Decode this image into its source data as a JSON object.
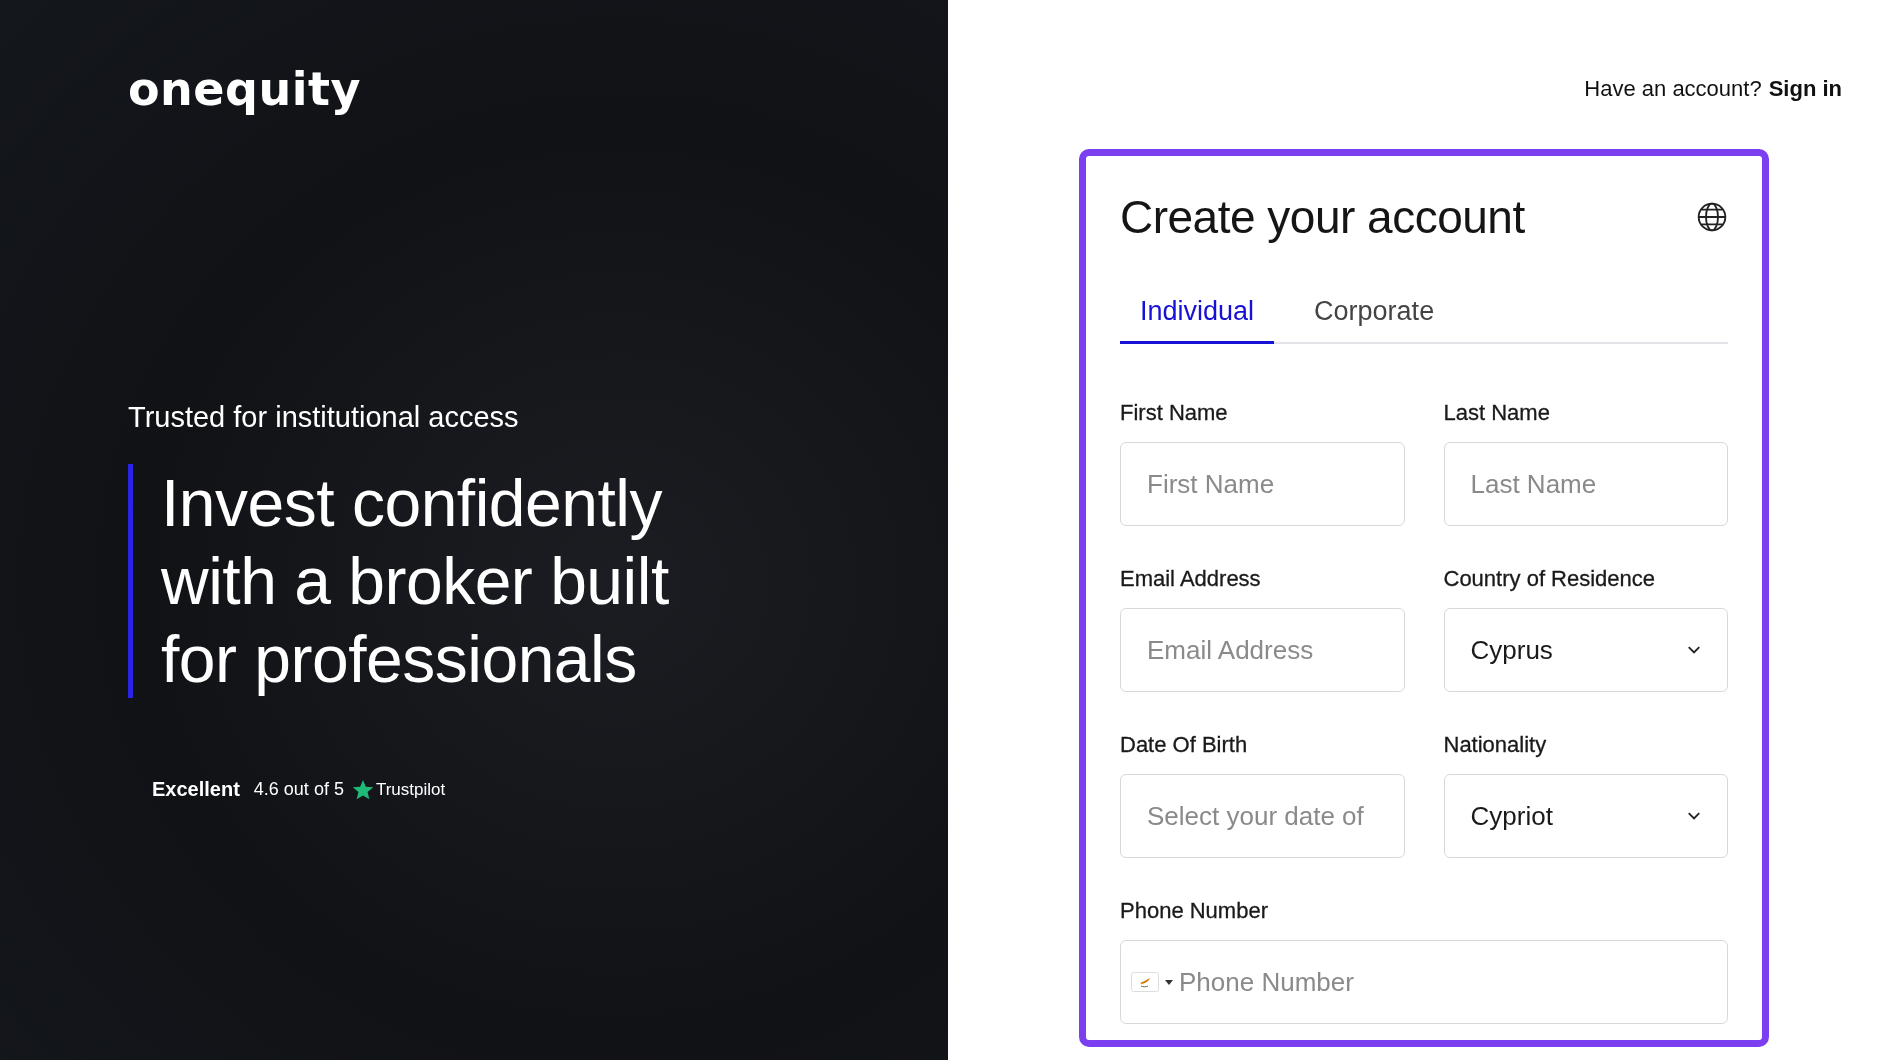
{
  "brand": {
    "logo": "onequity",
    "tagline": "Trusted for institutional access",
    "headline": [
      "Invest confidently",
      "with a broker built",
      "for professionals"
    ],
    "rating": {
      "label": "Excellent",
      "score": "4.6 out of 5",
      "provider": "Trustpilot"
    }
  },
  "header": {
    "prompt": "Have an account?",
    "link": "Sign in"
  },
  "form": {
    "title": "Create your account",
    "tabs": [
      {
        "label": "Individual",
        "selected": true
      },
      {
        "label": "Corporate",
        "selected": false
      }
    ],
    "fields": [
      {
        "kind": "text",
        "label": "First Name",
        "placeholder": "First Name"
      },
      {
        "kind": "text",
        "label": "Last Name",
        "placeholder": "Last Name"
      },
      {
        "kind": "text",
        "label": "Email Address",
        "placeholder": "Email Address"
      },
      {
        "kind": "select",
        "label": "Country of Residence",
        "value": "Cyprus"
      },
      {
        "kind": "text",
        "label": "Date Of Birth",
        "placeholder": "Select your date of"
      },
      {
        "kind": "select",
        "label": "Nationality",
        "value": "Cypriot"
      },
      {
        "kind": "phone",
        "label": "Phone Number",
        "placeholder": "Phone Number"
      }
    ]
  }
}
